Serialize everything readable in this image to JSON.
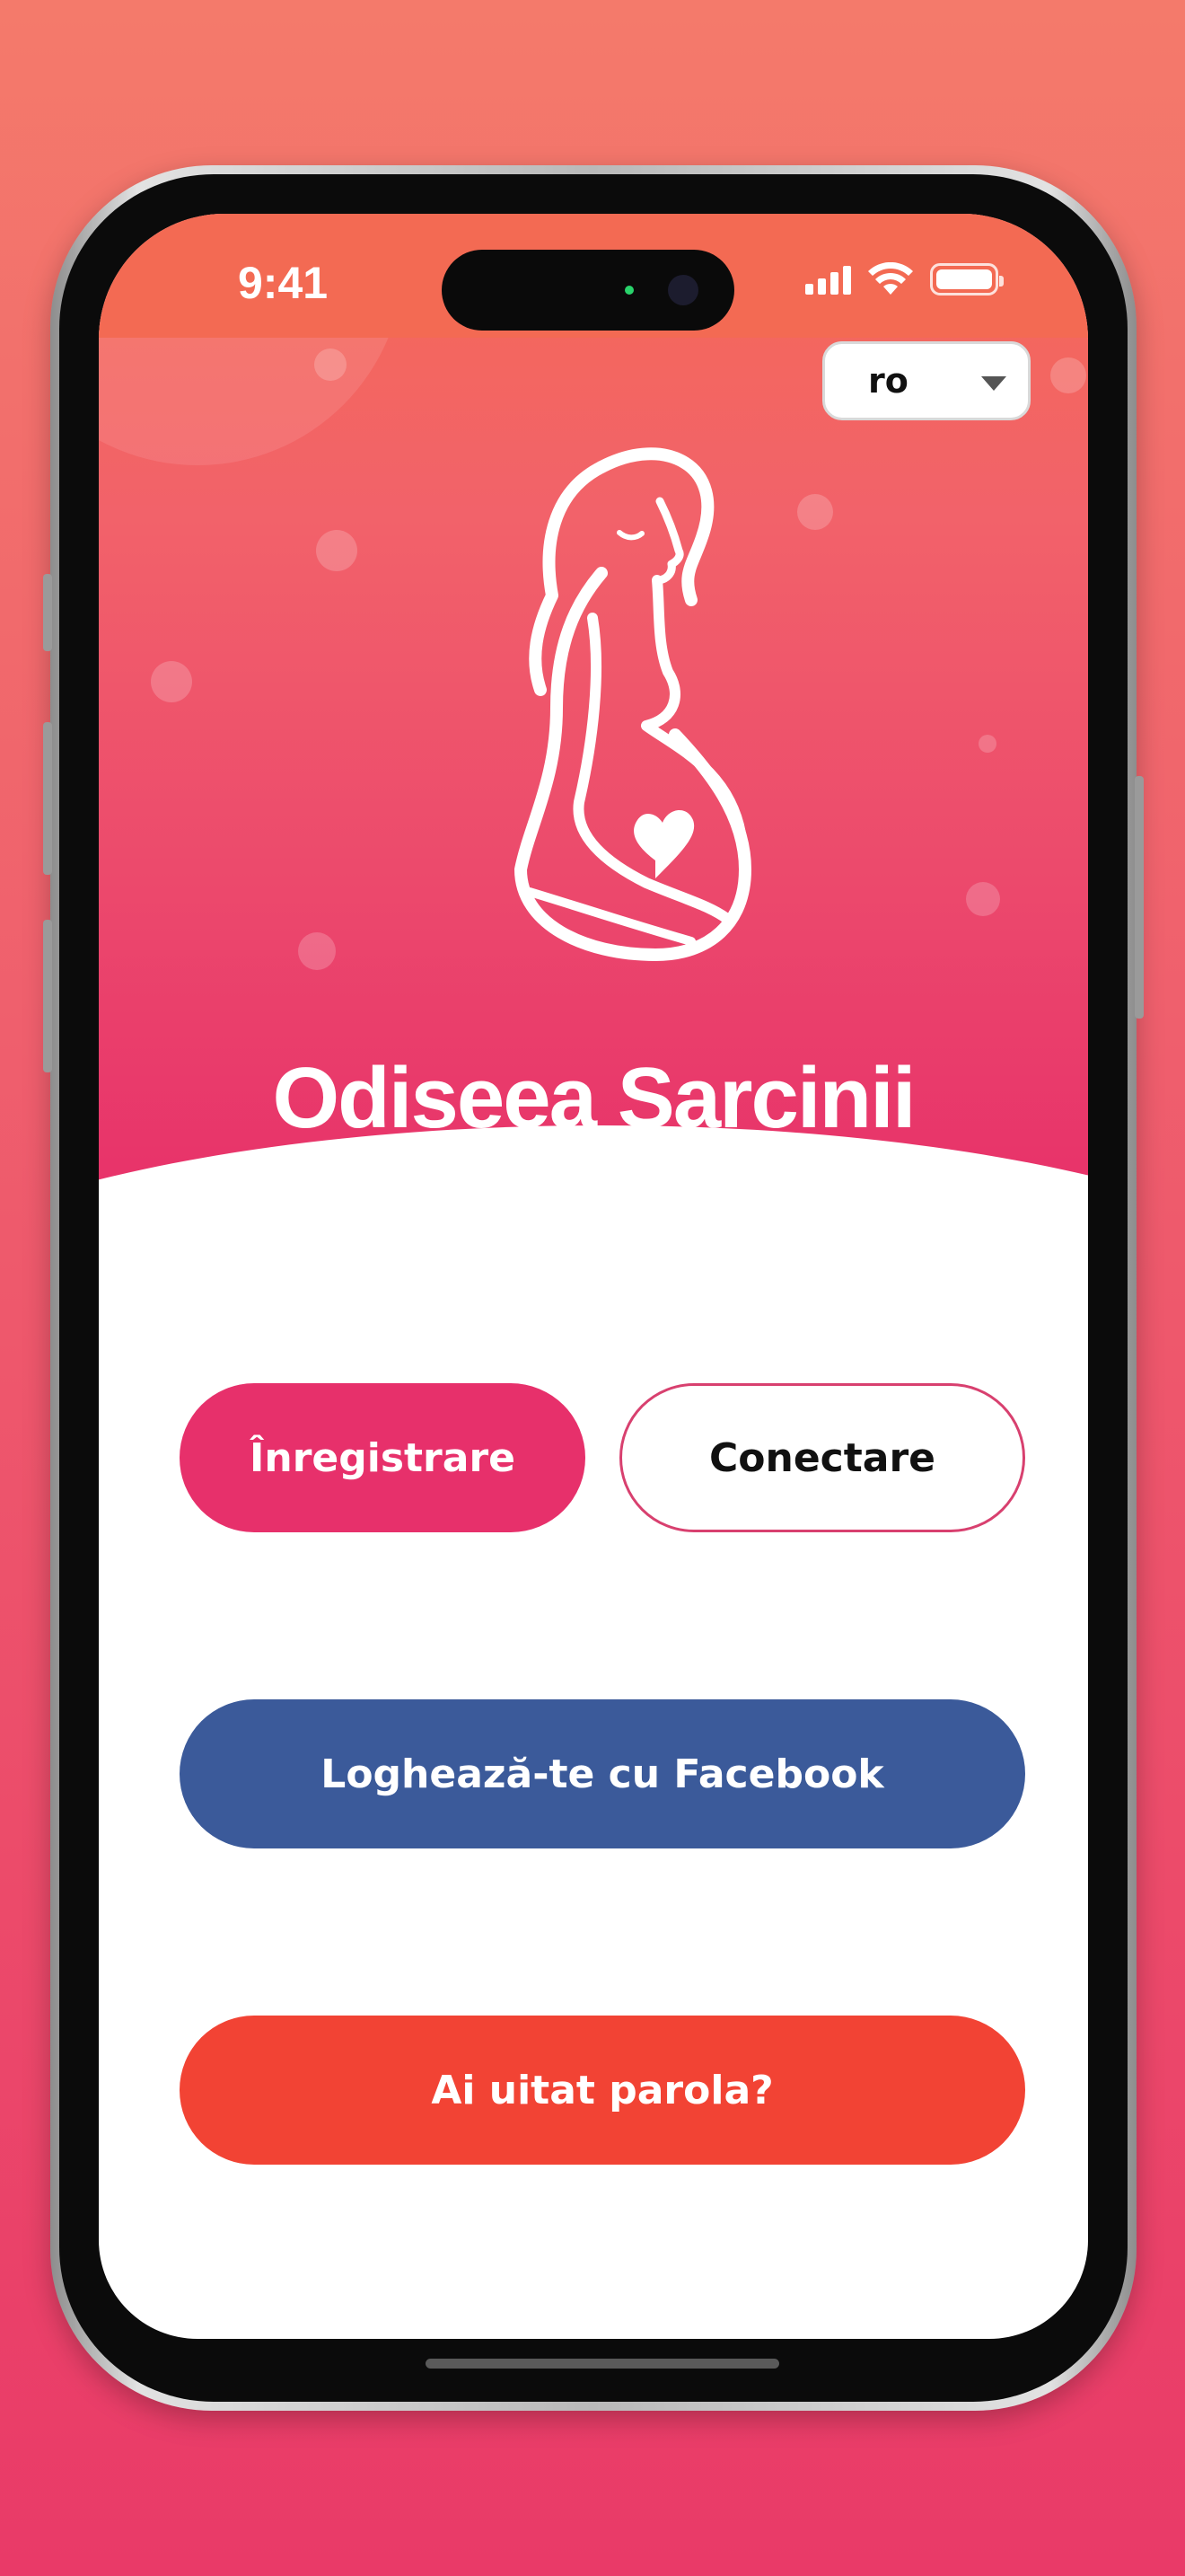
{
  "status_bar": {
    "time": "9:41"
  },
  "language_select": {
    "selected": "ro"
  },
  "header": {
    "app_title": "Odiseea Sarcinii"
  },
  "buttons": {
    "register": "Înregistrare",
    "login": "Conectare",
    "facebook": "Loghează-te cu Facebook",
    "forgot_password": "Ai uitat parola?"
  },
  "colors": {
    "header_top": "#f46a57",
    "header_bottom": "#e7306a",
    "register": "#e7306b",
    "facebook": "#3b5a9a",
    "forgot": "#f24334"
  },
  "icons": [
    "signal-icon",
    "wifi-icon",
    "battery-icon",
    "pregnant-woman-logo",
    "heart-icon",
    "chevron-down-icon"
  ]
}
